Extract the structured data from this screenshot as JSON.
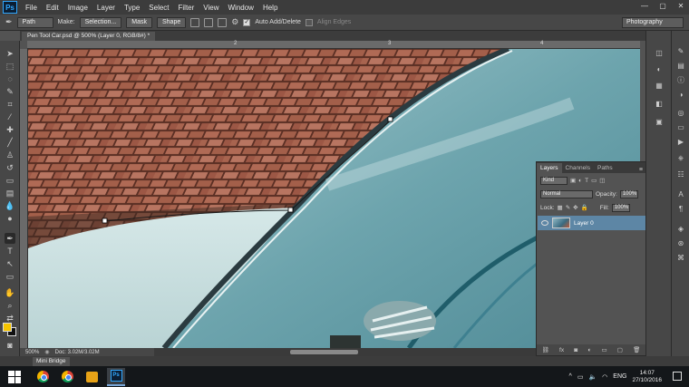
{
  "app": {
    "logo": "Ps",
    "window_controls": [
      "—",
      "▢",
      "✕"
    ]
  },
  "menu": [
    "File",
    "Edit",
    "Image",
    "Layer",
    "Type",
    "Select",
    "Filter",
    "View",
    "Window",
    "Help"
  ],
  "options": {
    "mode": "Path",
    "make_label": "Make:",
    "selection_btn": "Selection...",
    "mask_btn": "Mask",
    "shape_btn": "Shape",
    "auto_add_delete": "Auto Add/Delete",
    "align_edges": "Align Edges",
    "workspace": "Photography"
  },
  "document": {
    "tab_title": "Pen Tool Car.psd @ 500% (Layer 0, RGB/8#) *"
  },
  "rulers": {
    "h_ticks": [
      "2",
      "3",
      "4"
    ]
  },
  "status": {
    "zoom": "500%",
    "doc_info": "Doc: 3.02M/3.02M"
  },
  "mini_bridge": {
    "label": "Mini Bridge"
  },
  "layers_panel": {
    "tabs": [
      "Layers",
      "Channels",
      "Paths"
    ],
    "filter_kind": "Kind",
    "blend_mode": "Normal",
    "opacity_label": "Opacity:",
    "opacity_value": "100%",
    "lock_label": "Lock:",
    "fill_label": "Fill:",
    "fill_value": "100%",
    "layers": [
      {
        "name": "Layer 0"
      }
    ],
    "bottom_icons": [
      "link-icon",
      "fx-icon",
      "mask-icon",
      "adjustment-icon",
      "group-icon",
      "new-layer-icon",
      "trash-icon"
    ]
  },
  "taskbar": {
    "lang": "ENG",
    "time": "14:07",
    "date": "27/10/2016"
  },
  "colors": {
    "accent": "#31a8ff",
    "fg_swatch": "#f5c400",
    "bg_swatch": "#111111",
    "layer_selected": "#5d86a5"
  }
}
